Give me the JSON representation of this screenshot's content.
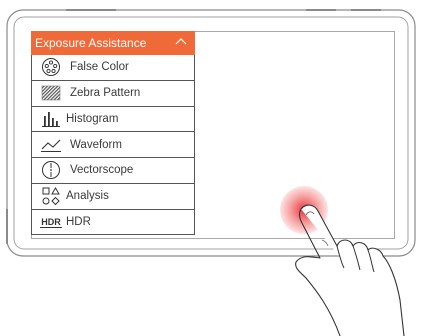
{
  "menu": {
    "title": "Exposure Assistance",
    "items": [
      {
        "label": "False Color",
        "icon": "false-color-icon"
      },
      {
        "label": "Zebra Pattern",
        "icon": "zebra-pattern-icon"
      },
      {
        "label": "Histogram",
        "icon": "histogram-icon"
      },
      {
        "label": "Waveform",
        "icon": "waveform-icon"
      },
      {
        "label": "Vectorscope",
        "icon": "vectorscope-icon"
      },
      {
        "label": "Analysis",
        "icon": "analysis-icon"
      },
      {
        "label": "HDR",
        "icon": "hdr-icon"
      }
    ],
    "hdr_icon_text": "HDR"
  },
  "colors": {
    "accent": "#ef6a38",
    "touch": "#e81e28",
    "outline": "#555555"
  }
}
